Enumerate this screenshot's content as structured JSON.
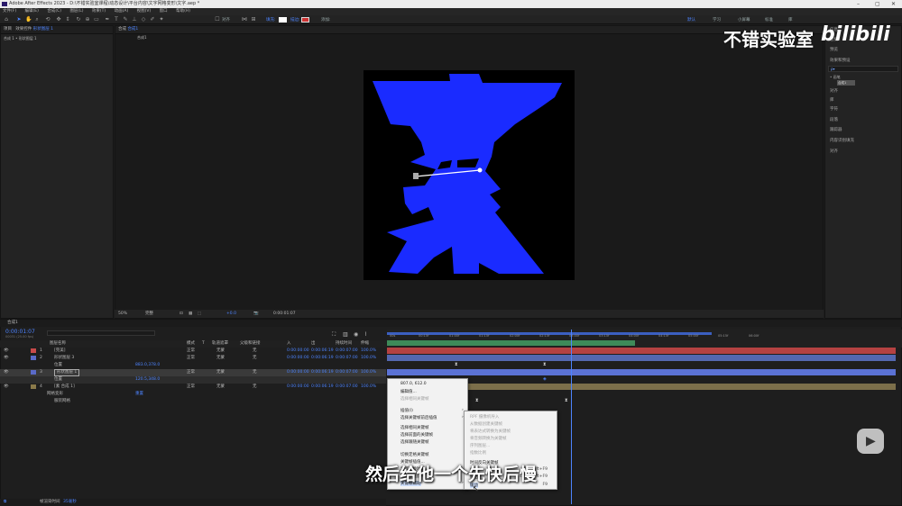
{
  "window": {
    "title": "Adobe After Effects 2023 - D:\\不错实验室课程\\动态设计\\平台内容\\文字网格变形\\文字.aep *",
    "minimize": "–",
    "maximize": "▢",
    "close": "✕"
  },
  "menu": [
    "文件(F)",
    "编辑(E)",
    "合成(C)",
    "图层(L)",
    "效果(T)",
    "动画(A)",
    "视图(V)",
    "窗口",
    "帮助(H)"
  ],
  "toolbar": {
    "align": "对齐",
    "fill_label": "填充:",
    "stroke_label": "描边:",
    "add_label": "添加:",
    "workspace": [
      "默认",
      "学习",
      "小屏幕",
      "标准",
      "库"
    ]
  },
  "project_panel": {
    "tab1": "项目",
    "tab2": "效果控件",
    "tab2_target": "形状图层 1",
    "breadcrumb": "合成 1 • 形状图层 1"
  },
  "comp_panel": {
    "tab": "合成",
    "tab_name": "合成1",
    "flow_tab": "合成1",
    "zoom": "50%",
    "quality": "完整",
    "exposure": "+0.0",
    "timecode": "0:00:01:07"
  },
  "right_panel": {
    "items": [
      "信息",
      "音频",
      "预览",
      "效果和预设",
      "对齐",
      "库",
      "字符",
      "段落",
      "跟踪器",
      "内容识别填充",
      "对齐"
    ],
    "search_placeholder": "ρ▾",
    "preset_label": "• 画笔",
    "dropdown": "合成1"
  },
  "watermark": {
    "brand": "不错实验室",
    "logo": "bilibili"
  },
  "timeline": {
    "tab": "合成1",
    "timecode": "0:00:01:07",
    "fps": "00031 (25.00 fps)",
    "columns": [
      "图层名称",
      "模式",
      "T",
      "轨道遮罩",
      "父级和链接",
      "入",
      "出",
      "持续时间",
      "伸缩"
    ],
    "ruler": [
      "00s",
      "00:15f",
      "01:00f",
      "01:15f",
      "02:00f",
      "02:15f",
      "03:00f",
      "03:15f",
      "04:00f",
      "04:15f",
      "05:00f",
      "05:15f",
      "06:00f"
    ],
    "layers": [
      {
        "num": "1",
        "name": "[完美]",
        "mode": "正常",
        "matte": "无蒙",
        "parent": "无",
        "in": "0:00:00:00",
        "out": "0:00:06:19",
        "dur": "0:00:07:00",
        "stretch": "100.0%"
      },
      {
        "num": "2",
        "name": "形状图层 3",
        "mode": "正常",
        "matte": "无蒙",
        "parent": "无",
        "in": "0:00:00:00",
        "out": "0:00:06:19",
        "dur": "0:00:07:00",
        "stretch": "100.0%"
      },
      {
        "num": "",
        "name": "位置",
        "mode": "",
        "matte": "",
        "parent": "",
        "in": "",
        "out": "",
        "dur": "",
        "stretch": "",
        "value": "883.0,378.0"
      },
      {
        "num": "3",
        "name": "形状图层 1",
        "mode": "正常",
        "matte": "无蒙",
        "parent": "无",
        "in": "0:00:00:00",
        "out": "0:00:06:19",
        "dur": "0:00:07:00",
        "stretch": "100.0%"
      },
      {
        "num": "",
        "name": "位置",
        "mode": "",
        "matte": "",
        "parent": "",
        "in": "",
        "out": "",
        "dur": "",
        "stretch": "",
        "value": "120.5,348.0"
      },
      {
        "num": "4",
        "name": "[素 合成 1]",
        "mode": "正常",
        "matte": "无蒙",
        "parent": "无",
        "in": "0:00:00:00",
        "out": "0:00:06:19",
        "dur": "0:00:07:00",
        "stretch": "100.0%"
      },
      {
        "num": "",
        "name": "网格变形",
        "mode": "",
        "matte": "",
        "parent": "",
        "in": "",
        "out": "",
        "dur": "",
        "stretch": "",
        "value": "重置"
      },
      {
        "num": "",
        "name": "服装网格",
        "mode": "",
        "matte": "",
        "parent": "",
        "in": "",
        "out": "",
        "dur": "",
        "stretch": "",
        "value": ""
      }
    ],
    "footer": "帧渲染时间",
    "footer_value": "35毫秒"
  },
  "context_menu": {
    "items": [
      "807.0, 612.0",
      "编辑值...",
      "选择相同关键帧",
      "插值(I)",
      "选择关键帧前后插值",
      "选择相同关键帧",
      "选择前面的关键帧",
      "选择跟随关键帧",
      "切换定格关键帧",
      "关键帧插值...",
      "漂浮穿梭时间",
      "关键帧速度...",
      "关键帧辅助"
    ],
    "submenu": [
      "RPF 摄像机导入",
      "从数据创建关键帧",
      "将表达式转换为关键帧",
      "将音频转换为关键帧",
      "序列图层...",
      "指数比例",
      "时间反向关键帧",
      "缓入",
      "缓出",
      "缓动"
    ],
    "submenu_shortcuts": [
      "Shift+F9",
      "Ctrl+Shift+F9",
      "F9"
    ]
  },
  "subtitle": "然后给他一个先快后慢",
  "colors": {
    "shape_fill": "#1a2bff",
    "accent": "#4d84ff"
  }
}
